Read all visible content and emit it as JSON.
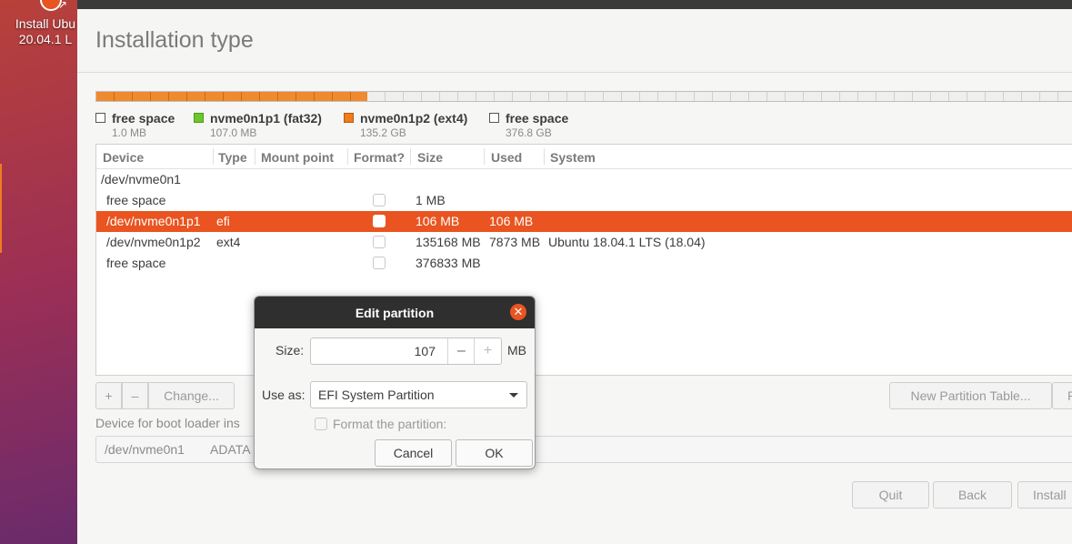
{
  "desktop": {
    "launcher_label": "Install Ubu\n20.04.1 L"
  },
  "window": {
    "title": "Installation type"
  },
  "legend": [
    {
      "name": "free space",
      "size": "1.0 MB",
      "color": "#ffffff"
    },
    {
      "name": "nvme0n1p1 (fat32)",
      "size": "107.0 MB",
      "color": "#6bc72b"
    },
    {
      "name": "nvme0n1p2 (ext4)",
      "size": "135.2 GB",
      "color": "#f07c1e"
    },
    {
      "name": "free space",
      "size": "376.8 GB",
      "color": "#ffffff"
    }
  ],
  "table": {
    "headers": {
      "device": "Device",
      "type": "Type",
      "mount": "Mount point",
      "format": "Format?",
      "size": "Size",
      "used": "Used",
      "system": "System"
    },
    "rows": [
      {
        "device": "/dev/nvme0n1",
        "type": "",
        "size": "",
        "used": "",
        "system": "",
        "has_checkbox": false
      },
      {
        "device": "free space",
        "type": "",
        "size": "1 MB",
        "used": "",
        "system": "",
        "has_checkbox": true
      },
      {
        "device": "/dev/nvme0n1p1",
        "type": "efi",
        "size": "106 MB",
        "used": "106 MB",
        "system": "",
        "has_checkbox": true
      },
      {
        "device": "/dev/nvme0n1p2",
        "type": "ext4",
        "size": "135168 MB",
        "used": "7873 MB",
        "system": "Ubuntu 18.04.1 LTS (18.04)",
        "has_checkbox": true
      },
      {
        "device": "free space",
        "type": "",
        "size": "376833 MB",
        "used": "",
        "system": "",
        "has_checkbox": true
      }
    ]
  },
  "table_buttons": {
    "add": "+",
    "remove": "–",
    "change": "Change...",
    "new_table": "New Partition Table...",
    "revert": "R"
  },
  "bootloader": {
    "label": "Device for boot loader ins",
    "device": "/dev/nvme0n1",
    "model": "ADATA"
  },
  "footer": {
    "quit": "Quit",
    "back": "Back",
    "install": "Install"
  },
  "dialog": {
    "title": "Edit partition",
    "size_label": "Size:",
    "size_value": "107",
    "size_unit": "MB",
    "use_as_label": "Use as:",
    "use_as_value": "EFI System Partition",
    "format_label": "Format the partition:",
    "cancel": "Cancel",
    "ok": "OK"
  },
  "colors": {
    "accent": "#e95420",
    "used_bar": "#ef8a2f"
  }
}
